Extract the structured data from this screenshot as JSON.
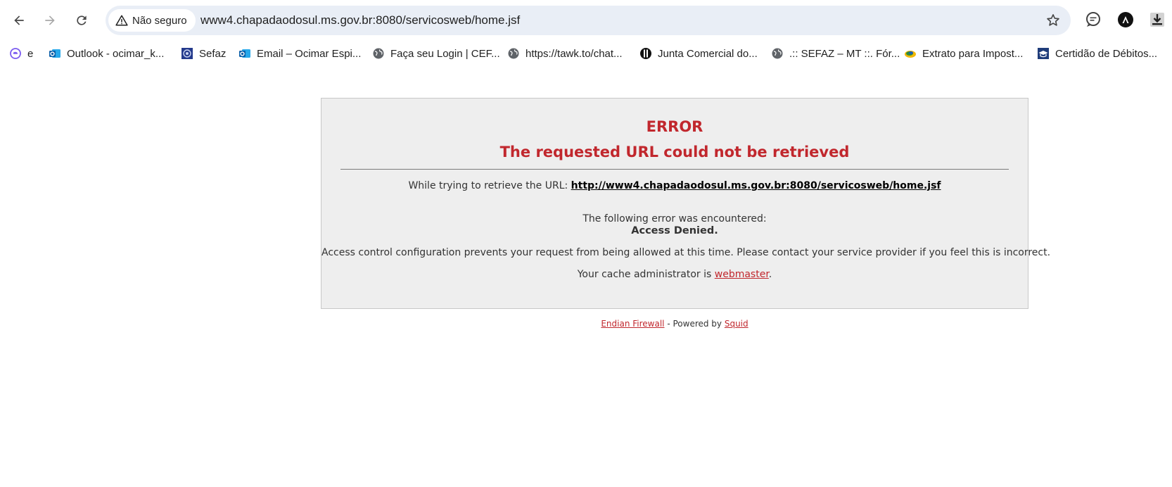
{
  "browser": {
    "security_label": "Não seguro",
    "url": "www4.chapadaodosul.ms.gov.br:8080/servicosweb/home.jsf",
    "icons": {
      "back": "arrow-left-icon",
      "forward": "arrow-right-icon",
      "reload": "reload-icon",
      "security": "warning-triangle-icon",
      "bookmark": "star-icon",
      "extension_1": "chat-bubble-icon",
      "extension_2": "letter-a-circle-icon",
      "download": "download-icon"
    }
  },
  "bookmarks": [
    {
      "label": "e",
      "icon": "swirl-e-icon"
    },
    {
      "label": "Outlook - ocimar_k...",
      "icon": "outlook-icon"
    },
    {
      "label": "Sefaz",
      "icon": "sefaz-crest-icon"
    },
    {
      "label": "Email – Ocimar Espi...",
      "icon": "outlook-icon"
    },
    {
      "label": "Faça seu Login | CEF...",
      "icon": "globe-icon"
    },
    {
      "label": "https://tawk.to/chat...",
      "icon": "globe-icon"
    },
    {
      "label": "Junta Comercial do...",
      "icon": "junta-icon"
    },
    {
      "label": ".:: SEFAZ – MT ::. Fór...",
      "icon": "globe-icon"
    },
    {
      "label": "Extrato para Impost...",
      "icon": "receita-icon"
    },
    {
      "label": "Certidão de Débitos...",
      "icon": "graduation-cap-icon"
    }
  ],
  "error_page": {
    "title": "ERROR",
    "subtitle": "The requested URL could not be retrieved",
    "url_prefix": "While trying to retrieve the URL: ",
    "url_link": "http://www4.chapadaodosul.ms.gov.br:8080/servicosweb/home.jsf",
    "encountered": "The following error was encountered:",
    "error_name": "Access Denied.",
    "description": "Access control configuration prevents your request from being allowed at this time. Please contact your service provider if you feel this is incorrect.",
    "admin_prefix": "Your cache administrator is ",
    "admin_link": "webmaster",
    "admin_suffix": ".",
    "footer_link_1": "Endian Firewall",
    "footer_middle": " - Powered by ",
    "footer_link_2": "Squid"
  },
  "colors": {
    "error_red": "#c1272d",
    "box_background": "#eeeeee",
    "omnibox_background": "#e9eef6"
  }
}
